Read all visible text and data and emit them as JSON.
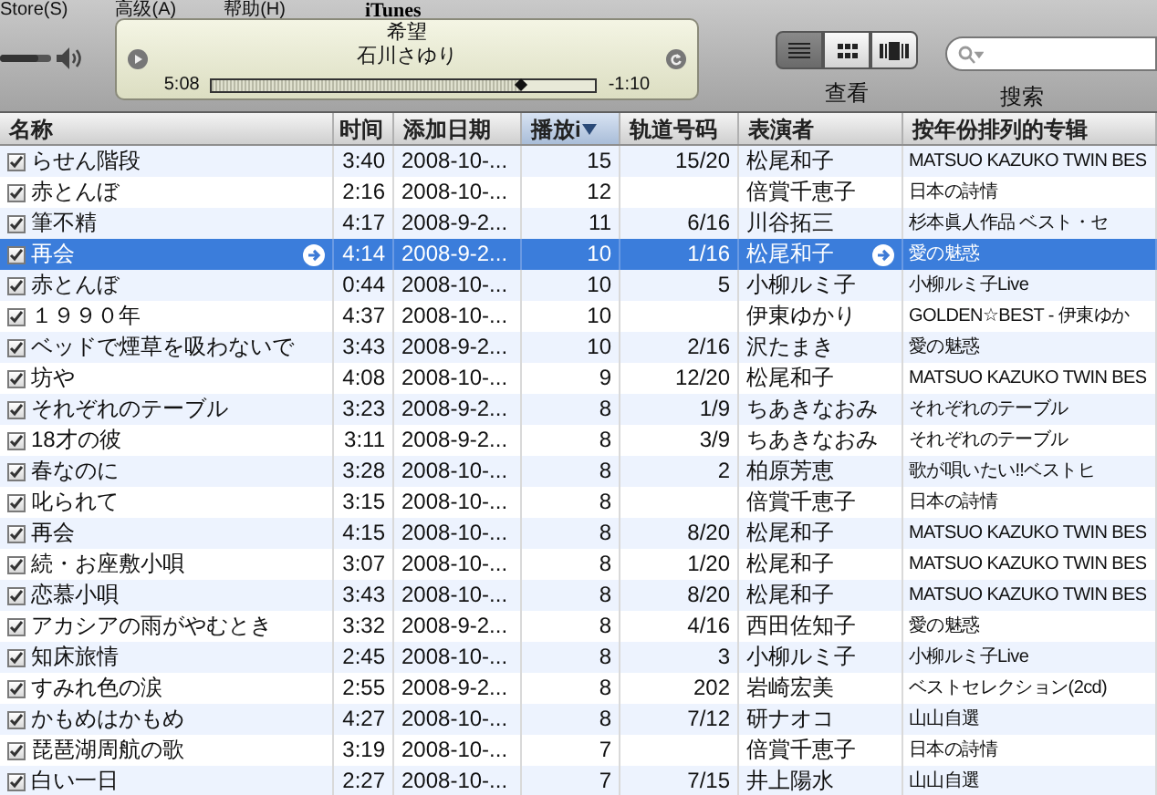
{
  "menu": [
    "Store(S)",
    "高级(A)",
    "帮助(H)"
  ],
  "window": {
    "title": "iTunes"
  },
  "volume": {
    "level": 0.75
  },
  "now_playing": {
    "title": "希望",
    "artist": "石川さゆり",
    "elapsed": "5:08",
    "remaining": "-1:10",
    "level": 0.81
  },
  "view": {
    "label": "查看",
    "buttons": [
      {
        "kind": "list",
        "selected": true
      },
      {
        "kind": "grid",
        "selected": false
      },
      {
        "kind": "coverflow",
        "selected": false
      }
    ]
  },
  "search": {
    "label": "搜索"
  },
  "table": {
    "columns": [
      {
        "label": "名称",
        "sorted": false
      },
      {
        "label": "时间",
        "sorted": false
      },
      {
        "label": "添加日期",
        "sorted": false
      },
      {
        "label": "播放i",
        "sorted": true
      },
      {
        "label": "轨道号码",
        "sorted": false
      },
      {
        "label": "表演者",
        "sorted": false
      },
      {
        "label": "按年份排列的专辑",
        "sorted": false
      }
    ],
    "rows": [
      {
        "name": "らせん階段",
        "time": "3:40",
        "date": "2008-10-...",
        "plays": "15",
        "track": "15/20",
        "artist": "松尾和子",
        "album": "MATSUO KAZUKO TWIN BES",
        "checked": true,
        "selected": false
      },
      {
        "name": "赤とんぼ",
        "time": "2:16",
        "date": "2008-10-...",
        "plays": "12",
        "track": "",
        "artist": "倍賞千恵子",
        "album": "日本の詩情",
        "checked": true,
        "selected": false
      },
      {
        "name": "筆不精",
        "time": "4:17",
        "date": "2008-9-2...",
        "plays": "11",
        "track": "6/16",
        "artist": "川谷拓三",
        "album": "杉本眞人作品 ベスト・セ",
        "checked": true,
        "selected": false
      },
      {
        "name": "再会",
        "time": "4:14",
        "date": "2008-9-2...",
        "plays": "10",
        "track": "1/16",
        "artist": "松尾和子",
        "album": "愛の魅惑",
        "checked": true,
        "selected": true
      },
      {
        "name": "赤とんぼ",
        "time": "0:44",
        "date": "2008-10-...",
        "plays": "10",
        "track": "5",
        "artist": "小柳ルミ子",
        "album": "小柳ルミ子Live",
        "checked": true,
        "selected": false
      },
      {
        "name": "１９９０年",
        "time": "4:37",
        "date": "2008-10-...",
        "plays": "10",
        "track": "",
        "artist": "伊東ゆかり",
        "album": "GOLDEN☆BEST - 伊東ゆか",
        "checked": true,
        "selected": false
      },
      {
        "name": "ベッドで煙草を吸わないで",
        "time": "3:43",
        "date": "2008-9-2...",
        "plays": "10",
        "track": "2/16",
        "artist": "沢たまき",
        "album": "愛の魅惑",
        "checked": true,
        "selected": false
      },
      {
        "name": "坊や",
        "time": "4:08",
        "date": "2008-10-...",
        "plays": "9",
        "track": "12/20",
        "artist": "松尾和子",
        "album": "MATSUO KAZUKO TWIN BES",
        "checked": true,
        "selected": false
      },
      {
        "name": "それぞれのテーブル",
        "time": "3:23",
        "date": "2008-9-2...",
        "plays": "8",
        "track": "1/9",
        "artist": "ちあきなおみ",
        "album": "それぞれのテーブル",
        "checked": true,
        "selected": false
      },
      {
        "name": "18才の彼",
        "time": "3:11",
        "date": "2008-9-2...",
        "plays": "8",
        "track": "3/9",
        "artist": "ちあきなおみ",
        "album": "それぞれのテーブル",
        "checked": true,
        "selected": false
      },
      {
        "name": "春なのに",
        "time": "3:28",
        "date": "2008-10-...",
        "plays": "8",
        "track": "2",
        "artist": "柏原芳恵",
        "album": "歌が唄いたい!!ベストヒ",
        "checked": true,
        "selected": false
      },
      {
        "name": "叱られて",
        "time": "3:15",
        "date": "2008-10-...",
        "plays": "8",
        "track": "",
        "artist": "倍賞千恵子",
        "album": "日本の詩情",
        "checked": true,
        "selected": false
      },
      {
        "name": "再会",
        "time": "4:15",
        "date": "2008-10-...",
        "plays": "8",
        "track": "8/20",
        "artist": "松尾和子",
        "album": "MATSUO KAZUKO TWIN BES",
        "checked": true,
        "selected": false
      },
      {
        "name": "続・お座敷小唄",
        "time": "3:07",
        "date": "2008-10-...",
        "plays": "8",
        "track": "1/20",
        "artist": "松尾和子",
        "album": "MATSUO KAZUKO TWIN BES",
        "checked": true,
        "selected": false
      },
      {
        "name": "恋慕小唄",
        "time": "3:43",
        "date": "2008-10-...",
        "plays": "8",
        "track": "8/20",
        "artist": "松尾和子",
        "album": "MATSUO KAZUKO TWIN BES",
        "checked": true,
        "selected": false
      },
      {
        "name": "アカシアの雨がやむとき",
        "time": "3:32",
        "date": "2008-9-2...",
        "plays": "8",
        "track": "4/16",
        "artist": "西田佐知子",
        "album": "愛の魅惑",
        "checked": true,
        "selected": false
      },
      {
        "name": "知床旅情",
        "time": "2:45",
        "date": "2008-10-...",
        "plays": "8",
        "track": "3",
        "artist": "小柳ルミ子",
        "album": "小柳ルミ子Live",
        "checked": true,
        "selected": false
      },
      {
        "name": "すみれ色の涙",
        "time": "2:55",
        "date": "2008-9-2...",
        "plays": "8",
        "track": "202",
        "artist": "岩崎宏美",
        "album": "ベストセレクション(2cd)",
        "checked": true,
        "selected": false
      },
      {
        "name": "かもめはかもめ",
        "time": "4:27",
        "date": "2008-10-...",
        "plays": "8",
        "track": "7/12",
        "artist": "研ナオコ",
        "album": "山山自選",
        "checked": true,
        "selected": false
      },
      {
        "name": "琵琶湖周航の歌",
        "time": "3:19",
        "date": "2008-10-...",
        "plays": "7",
        "track": "",
        "artist": "倍賞千恵子",
        "album": "日本の詩情",
        "checked": true,
        "selected": false
      },
      {
        "name": "白い一日",
        "time": "2:27",
        "date": "2008-10-...",
        "plays": "7",
        "track": "7/15",
        "artist": "井上陽水",
        "album": "山山自選",
        "checked": true,
        "selected": false
      }
    ]
  }
}
